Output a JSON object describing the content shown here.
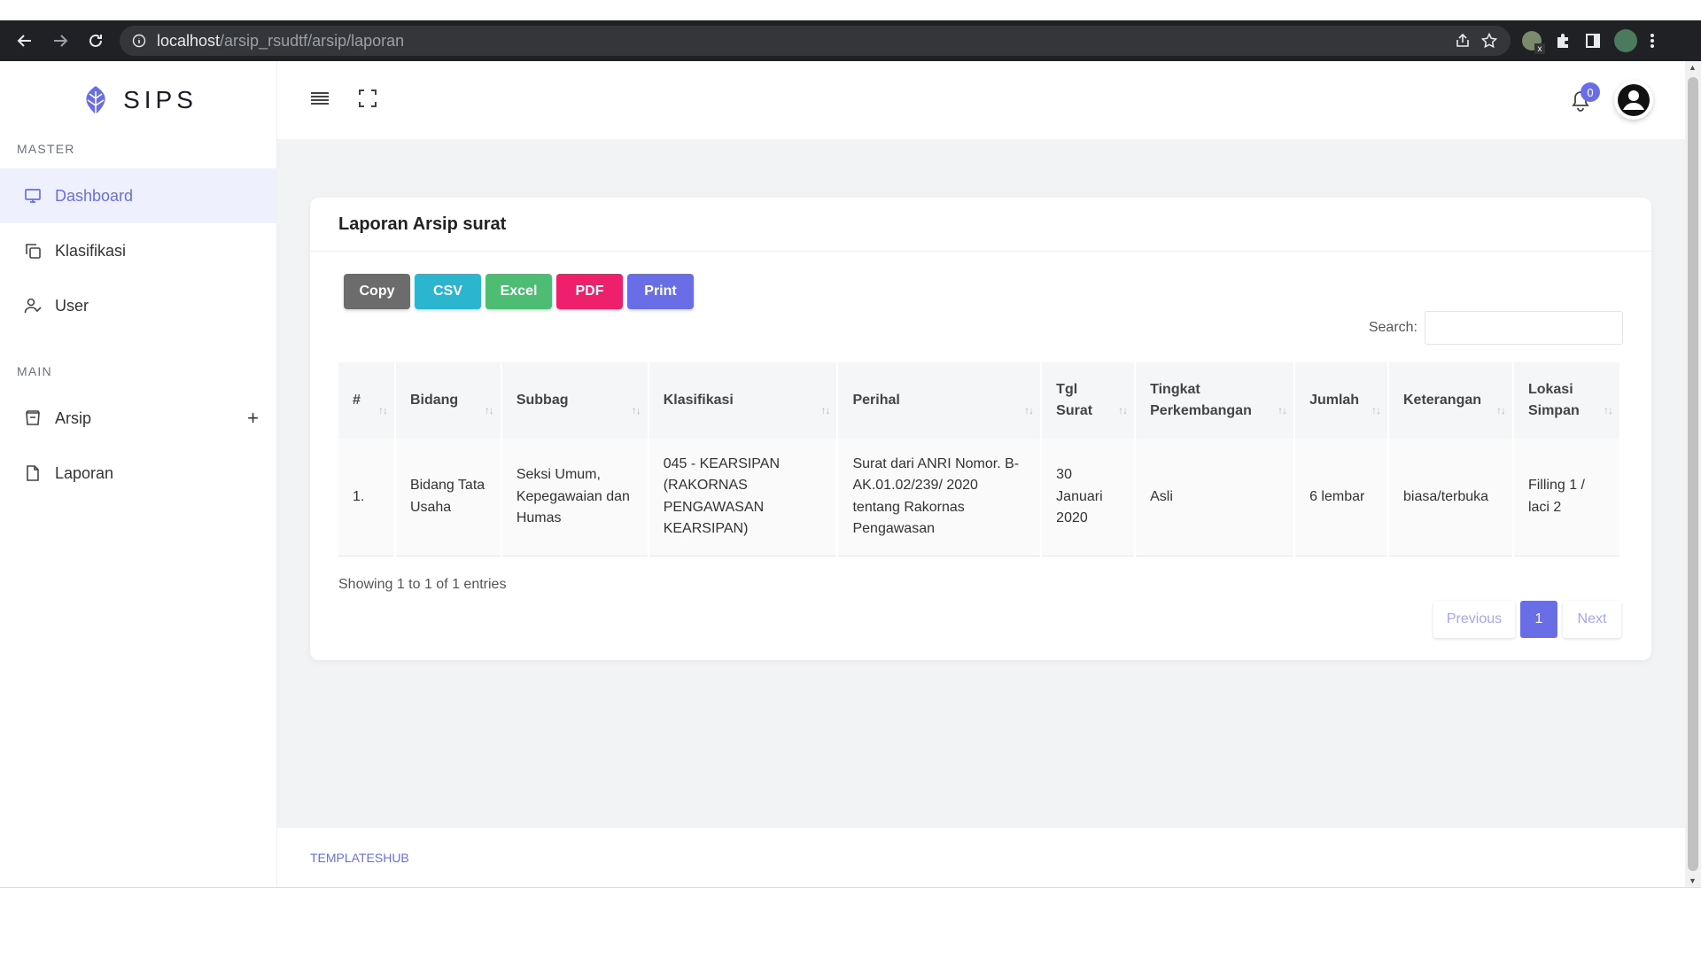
{
  "browser": {
    "url_host": "localhost",
    "url_path": "/arsip_rsudtf/arsip/laporan"
  },
  "brand": {
    "name": "SIPS"
  },
  "sidebar": {
    "sections": [
      {
        "label": "MASTER"
      },
      {
        "label": "MAIN"
      }
    ],
    "items": [
      {
        "label": "Dashboard",
        "icon": "monitor-icon",
        "active": true
      },
      {
        "label": "Klasifikasi",
        "icon": "copy-icon"
      },
      {
        "label": "User",
        "icon": "user-check-icon"
      },
      {
        "label": "Arsip",
        "icon": "archive-icon",
        "expand": "+"
      },
      {
        "label": "Laporan",
        "icon": "file-icon"
      }
    ]
  },
  "topbar": {
    "notif_count": "0"
  },
  "card": {
    "title": "Laporan Arsip surat",
    "buttons": [
      {
        "label": "Copy",
        "color": "#6c6c6c"
      },
      {
        "label": "CSV",
        "color": "#2bb5cf"
      },
      {
        "label": "Excel",
        "color": "#4dbd74"
      },
      {
        "label": "PDF",
        "color": "#ee1f6b"
      },
      {
        "label": "Print",
        "color": "#6a6ee6"
      }
    ],
    "search_label": "Search:"
  },
  "table": {
    "headers": [
      "#",
      "Bidang",
      "Subbag",
      "Klasifikasi",
      "Perihal",
      "Tgl Surat",
      "Tingkat Perkembangan",
      "Jumlah",
      "Keterangan",
      "Lokasi Simpan"
    ],
    "rows": [
      [
        "1.",
        "Bidang Tata Usaha",
        "Seksi Umum, Kepegawaian dan Humas",
        "045 - KEARSIPAN (RAKORNAS PENGAWASAN KEARSIPAN)",
        "Surat dari ANRI Nomor. B-AK.01.02/239/ 2020 tentang Rakornas Pengawasan",
        "30 Januari 2020",
        "Asli",
        "6 lembar",
        "biasa/terbuka",
        "Filling 1 / laci 2"
      ]
    ]
  },
  "pagination": {
    "info": "Showing 1 to 1 of 1 entries",
    "previous": "Previous",
    "current": "1",
    "next": "Next"
  },
  "footer": {
    "text": "TEMPLATESHUB"
  }
}
